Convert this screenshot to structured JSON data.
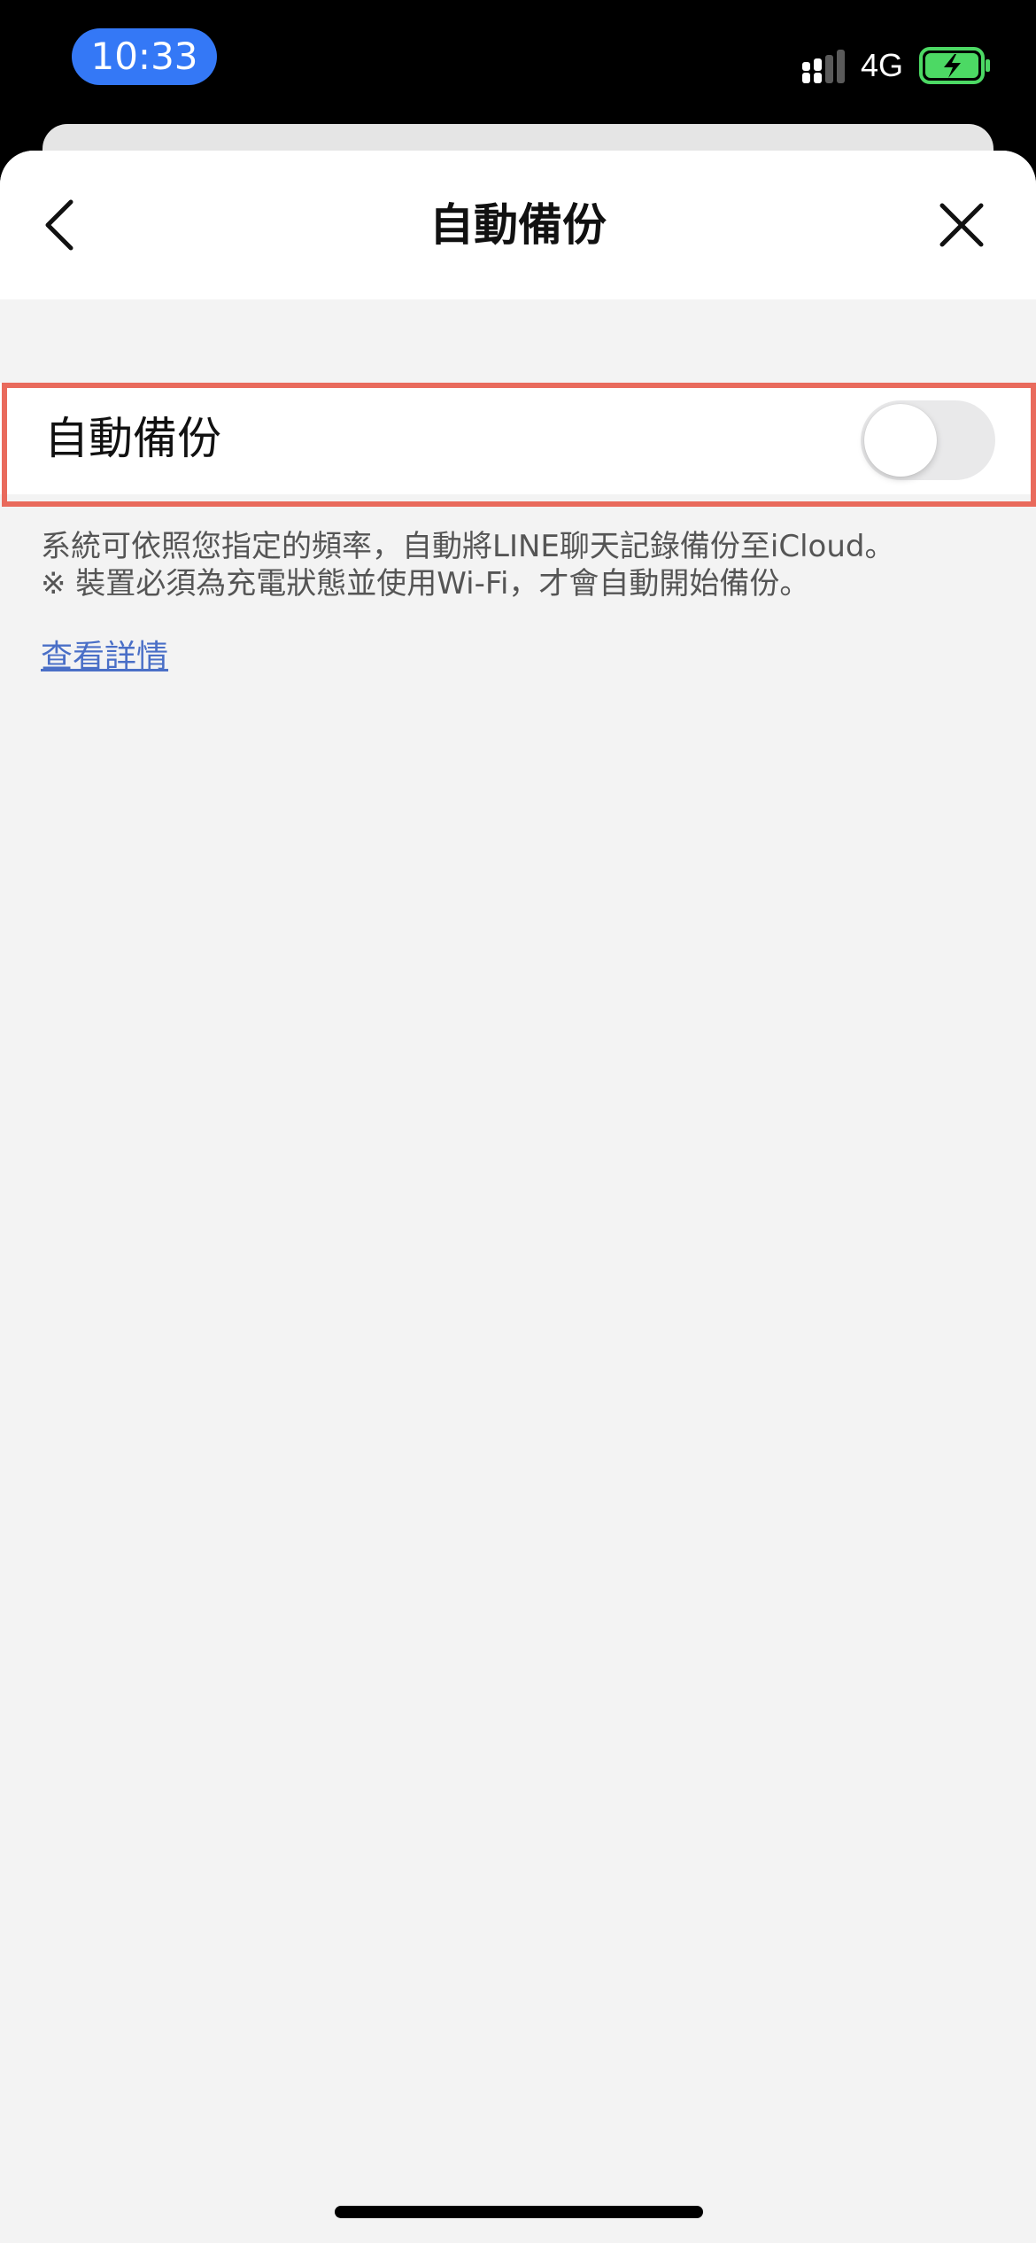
{
  "status_bar": {
    "time": "10:33",
    "network": "4G",
    "battery_charging": true,
    "icons": [
      "signal-icon",
      "battery-charging-icon"
    ]
  },
  "nav": {
    "title": "自動備份",
    "icons": [
      "back-chevron-icon",
      "close-icon"
    ]
  },
  "setting": {
    "label": "自動備份",
    "enabled": false
  },
  "description": {
    "line1": "系統可依照您指定的頻率，自動將LINE聊天記錄備份至iCloud。",
    "line2": "※ 裝置必須為充電狀態並使用Wi-Fi，才會自動開始備份。"
  },
  "link": {
    "label": "查看詳情"
  },
  "colors": {
    "time_pill": "#3478f6",
    "highlight_border": "#e96a5c",
    "link": "#4a6fc7",
    "battery_fill": "#4cd964",
    "sheet_background": "#f3f3f3"
  }
}
